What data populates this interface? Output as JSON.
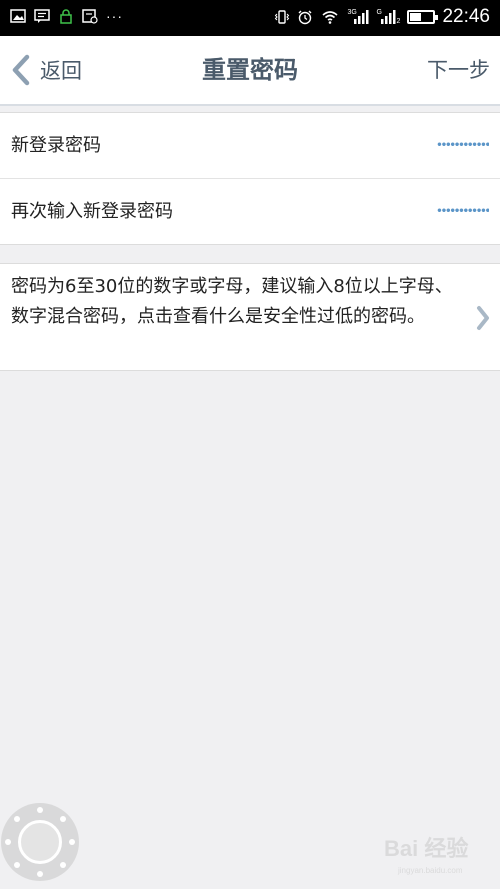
{
  "status_bar": {
    "network_4g_label": "3G",
    "network_2g_label": "G",
    "sim2_label": "2",
    "battery_level": 0.5,
    "time": "22:46",
    "more_notifications": "···"
  },
  "nav": {
    "back_label": "返回",
    "title": "重置密码",
    "next_label": "下一步"
  },
  "form": {
    "new_password_label": "新登录密码",
    "new_password_value": "••••••••••••",
    "confirm_password_label": "再次输入新登录密码",
    "confirm_password_value": "••••••••••••"
  },
  "hint": {
    "text": "密码为6至30位的数字或字母，建议输入8位以上字母、数字混合密码，点击查看什么是安全性过低的密码。"
  },
  "watermark": {
    "logo": "Bai 经验",
    "url": "jingyan.baidu.com"
  },
  "colors": {
    "nav_text": "#4a5a6a",
    "password_dots": "#5b95c8",
    "background": "#f0f0f2"
  }
}
